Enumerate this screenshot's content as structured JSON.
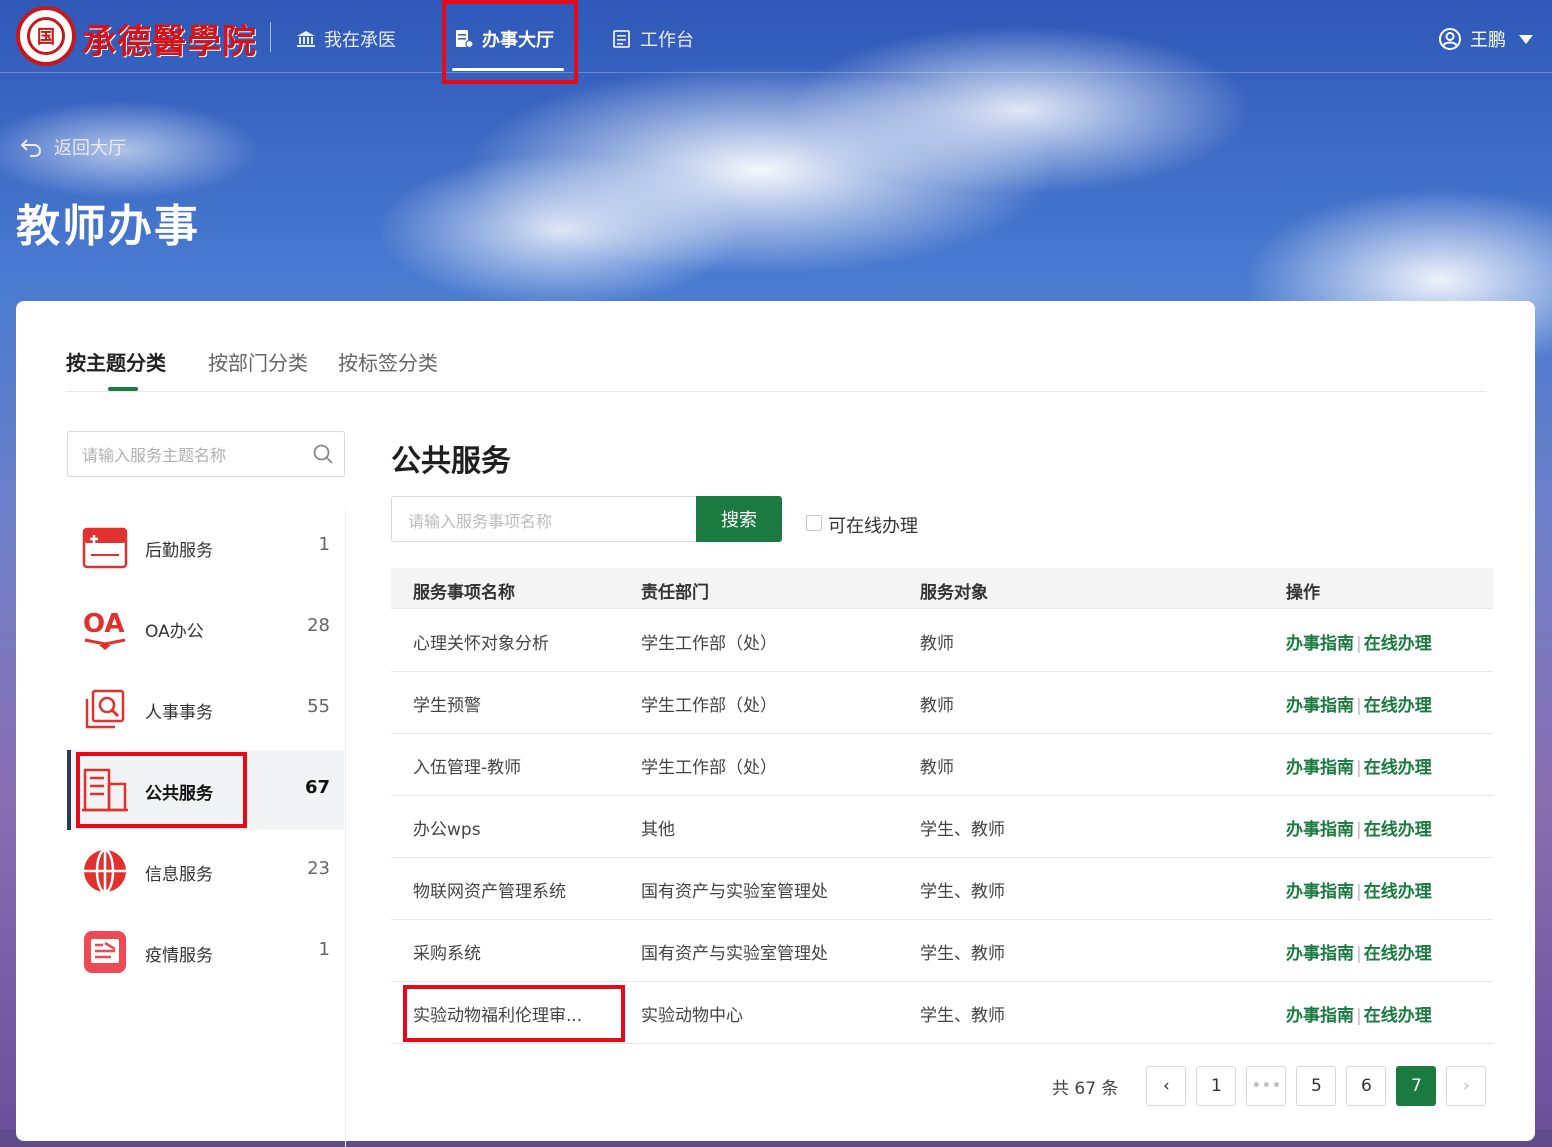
{
  "header": {
    "logo_text": "承德醫學院",
    "logo_mark": "国",
    "nav": [
      {
        "label": "我在承医"
      },
      {
        "label": "办事大厅"
      },
      {
        "label": "工作台"
      }
    ],
    "user_name": "王鹏"
  },
  "hero": {
    "back_label": "返回大厅",
    "title": "教师办事"
  },
  "tabs": [
    {
      "label": "按主题分类"
    },
    {
      "label": "按部门分类"
    },
    {
      "label": "按标签分类"
    }
  ],
  "sidebar": {
    "search_placeholder": "请输入服务主题名称",
    "items": [
      {
        "label": "后勤服务",
        "count": "1"
      },
      {
        "label": "OA办公",
        "count": "28"
      },
      {
        "label": "人事事务",
        "count": "55"
      },
      {
        "label": "公共服务",
        "count": "67"
      },
      {
        "label": "信息服务",
        "count": "23"
      },
      {
        "label": "疫情服务",
        "count": "1"
      }
    ]
  },
  "main": {
    "section_title": "公共服务",
    "search_placeholder": "请输入服务事项名称",
    "search_button": "搜索",
    "online_checkbox_label": "可在线办理",
    "columns": [
      "服务事项名称",
      "责任部门",
      "服务对象",
      "操作"
    ],
    "rows": [
      {
        "name": "心理关怀对象分析",
        "dept": "学生工作部（处）",
        "target": "教师"
      },
      {
        "name": "学生预警",
        "dept": "学生工作部（处）",
        "target": "教师"
      },
      {
        "name": "入伍管理-教师",
        "dept": "学生工作部（处）",
        "target": "教师"
      },
      {
        "name": "办公wps",
        "dept": "其他",
        "target": "学生、教师"
      },
      {
        "name": "物联网资产管理系统",
        "dept": "国有资产与实验室管理处",
        "target": "学生、教师"
      },
      {
        "name": "采购系统",
        "dept": "国有资产与实验室管理处",
        "target": "学生、教师"
      },
      {
        "name": "实验动物福利伦理审...",
        "dept": "实验动物中心",
        "target": "学生、教师"
      }
    ],
    "op_guide": "办事指南",
    "op_online": "在线办理",
    "pagination": {
      "total": "共 67 条",
      "pages": [
        "1",
        "•••",
        "5",
        "6",
        "7"
      ],
      "current": "7",
      "prev": "‹",
      "next": "›"
    }
  },
  "colors": {
    "brand_red": "#c8161d",
    "accent_green": "#1a7a40",
    "highlight_red": "#e5091a"
  }
}
